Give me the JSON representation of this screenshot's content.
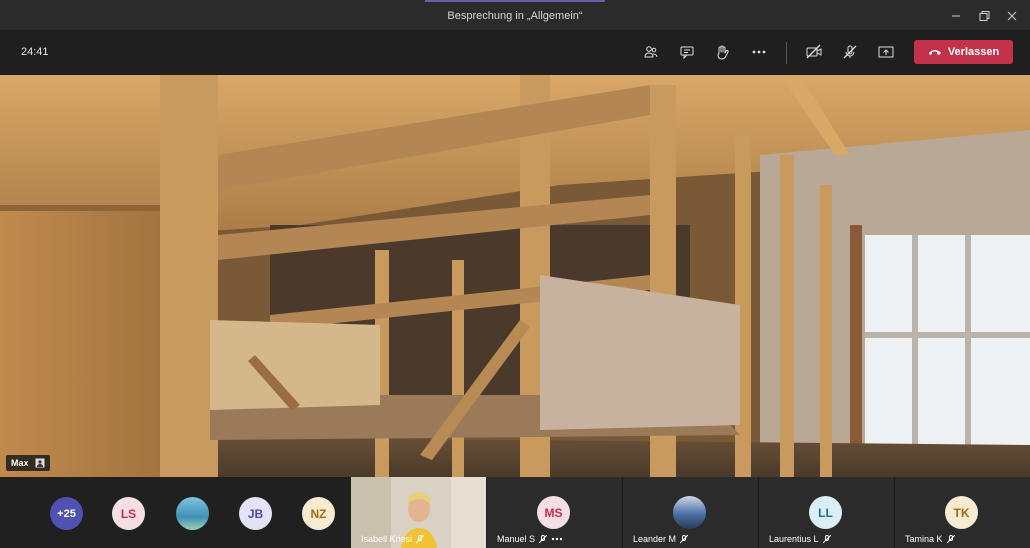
{
  "window": {
    "title": "Besprechung in „Allgemein“"
  },
  "toolbar": {
    "timer": "24:41",
    "buttons": [
      {
        "name": "participants-icon"
      },
      {
        "name": "chat-icon"
      },
      {
        "name": "raise-hand-icon"
      },
      {
        "name": "more-options-icon"
      },
      {
        "name": "camera-off-icon"
      },
      {
        "name": "mic-off-icon"
      },
      {
        "name": "share-screen-icon"
      }
    ],
    "leave_label": "Verlassen"
  },
  "main_video": {
    "speaker_name": "Max"
  },
  "participants": {
    "overflow": "+25",
    "avatars": [
      {
        "initials": "LS",
        "bg": "#f6dfe4",
        "fg": "#c4314b"
      },
      {
        "initials": "",
        "bg": "#5aa9cf"
      },
      {
        "initials": "JB",
        "bg": "#e3e3f5",
        "fg": "#4b4ea3"
      },
      {
        "initials": "NZ",
        "bg": "#f7ecd1",
        "fg": "#a46a16"
      }
    ],
    "tiles": [
      {
        "name": "Isabell Kriesi",
        "type": "video"
      },
      {
        "name": "Manuel S",
        "initials": "MS",
        "bg": "#f6dfe4",
        "fg": "#c4314b"
      },
      {
        "name": "Leander M",
        "type": "photo"
      },
      {
        "name": "Laurentius L",
        "initials": "LL",
        "bg": "#d9eef5",
        "fg": "#1f6f8b"
      },
      {
        "name": "Tamina K",
        "initials": "TK",
        "bg": "#f7ecd1",
        "fg": "#a46a16"
      }
    ]
  },
  "colors": {
    "accent": "#6264a7",
    "leave": "#c4314b",
    "toolbar_bg": "#1f1f1f"
  }
}
